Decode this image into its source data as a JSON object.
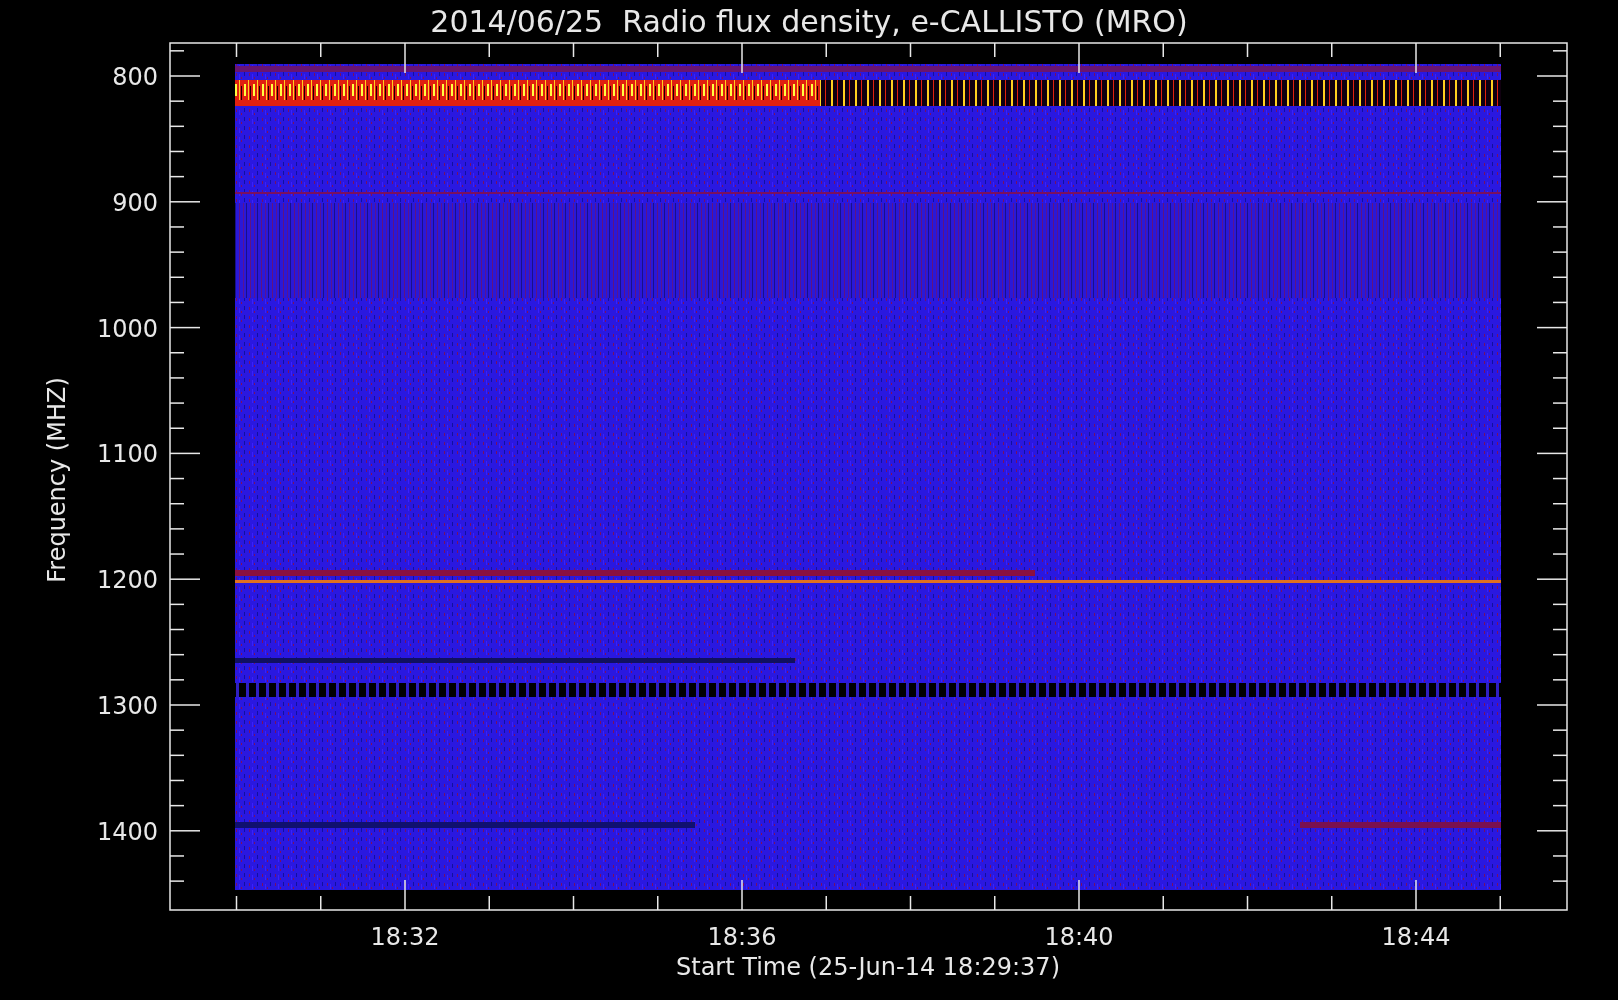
{
  "title": "2014/06/25  Radio flux density, e-CALLISTO (MRO)",
  "y_axis": {
    "label": "Frequency (MHZ)",
    "ticks": [
      "800",
      "900",
      "1000",
      "1100",
      "1200",
      "1300",
      "1400"
    ]
  },
  "x_axis": {
    "label": "Start Time (25-Jun-14 18:29:37)",
    "ticks": [
      "18:32",
      "18:36",
      "18:40",
      "18:44"
    ]
  }
}
